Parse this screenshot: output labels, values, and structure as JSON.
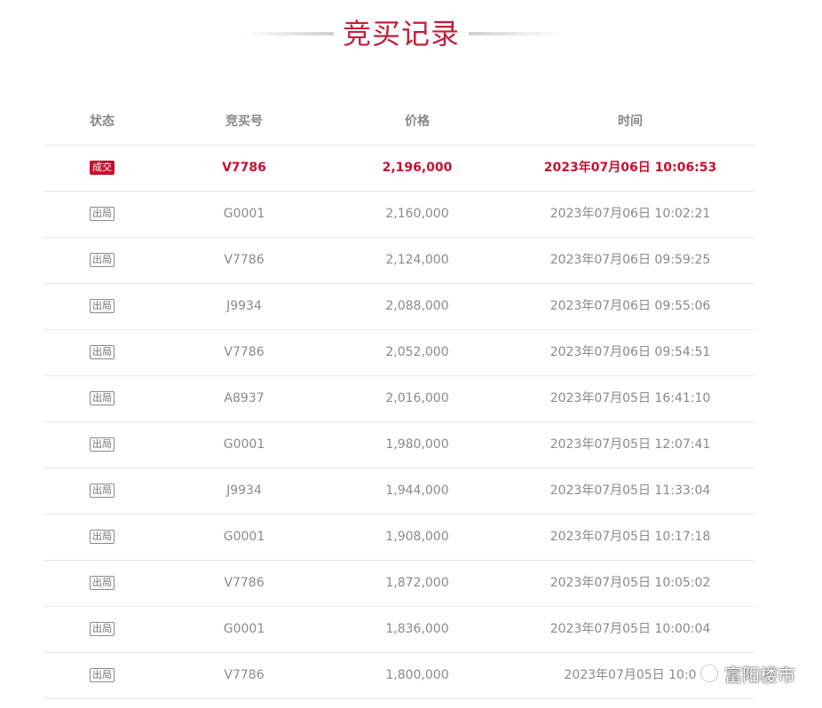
{
  "title": "竞买记录",
  "headers": {
    "status": "状态",
    "bid_no": "竞买号",
    "price": "价格",
    "time": "时间"
  },
  "rows": [
    {
      "status": "成交",
      "bid_no": "V7786",
      "price": "2,196,000",
      "time": "2023年07月06日 10:06:53"
    },
    {
      "status": "出局",
      "bid_no": "G0001",
      "price": "2,160,000",
      "time": "2023年07月06日 10:02:21"
    },
    {
      "status": "出局",
      "bid_no": "V7786",
      "price": "2,124,000",
      "time": "2023年07月06日 09:59:25"
    },
    {
      "status": "出局",
      "bid_no": "J9934",
      "price": "2,088,000",
      "time": "2023年07月06日 09:55:06"
    },
    {
      "status": "出局",
      "bid_no": "V7786",
      "price": "2,052,000",
      "time": "2023年07月06日 09:54:51"
    },
    {
      "status": "出局",
      "bid_no": "A8937",
      "price": "2,016,000",
      "time": "2023年07月05日 16:41:10"
    },
    {
      "status": "出局",
      "bid_no": "G0001",
      "price": "1,980,000",
      "time": "2023年07月05日 12:07:41"
    },
    {
      "status": "出局",
      "bid_no": "J9934",
      "price": "1,944,000",
      "time": "2023年07月05日 11:33:04"
    },
    {
      "status": "出局",
      "bid_no": "G0001",
      "price": "1,908,000",
      "time": "2023年07月05日 10:17:18"
    },
    {
      "status": "出局",
      "bid_no": "V7786",
      "price": "1,872,000",
      "time": "2023年07月05日 10:05:02"
    },
    {
      "status": "出局",
      "bid_no": "G0001",
      "price": "1,836,000",
      "time": "2023年07月05日 10:00:04"
    },
    {
      "status": "出局",
      "bid_no": "V7786",
      "price": "1,800,000",
      "time": "2023年07月05日 10:0"
    }
  ],
  "watermark": {
    "text": "富阳楼市",
    "icon": "wechat-channel-icon"
  },
  "colors": {
    "accent": "#c8102e",
    "text": "#8a8a8a",
    "divider": "#e6e6e6"
  }
}
